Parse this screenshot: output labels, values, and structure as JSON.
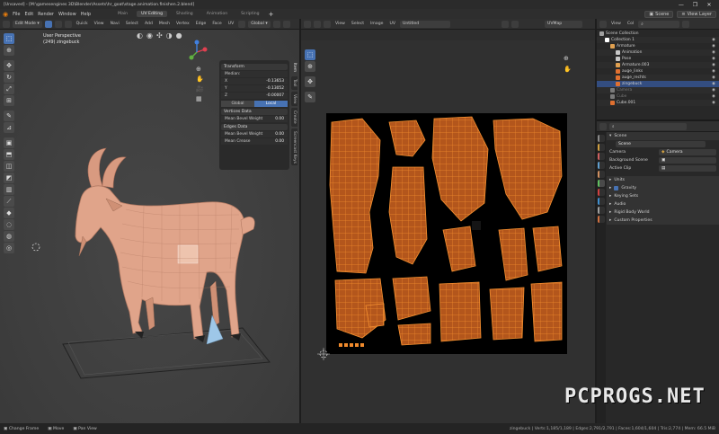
{
  "window": {
    "title": "[Unsaved] - [M:\\gamesengines 3D\\Blender\\Assets\\hr_goat\\stage.animation.finishen.2.blend]",
    "controls": [
      "—",
      "❐",
      "✕"
    ]
  },
  "menu": {
    "items": [
      "File",
      "Edit",
      "Render",
      "Window",
      "Help"
    ],
    "workspaces": [
      "Main",
      "UV Editing",
      "Shading",
      "Animation",
      "Scripting"
    ],
    "active_workspace": "UV Editing",
    "scene": "Scene",
    "view_layer": "View Layer"
  },
  "viewport3d": {
    "mode": "Edit Mode",
    "header_items": [
      "Quick",
      "View",
      "Navi",
      "Select",
      "Add",
      "Mesh",
      "Vertex",
      "Edge",
      "Face",
      "UV"
    ],
    "orientation": "Global",
    "view_name": "User Perspective",
    "object_name": "(249) zingebuck",
    "tools": [
      "select",
      "cursor",
      "move",
      "rotate",
      "scale",
      "transform",
      "annotate",
      "measure",
      "add-cube",
      "extrude",
      "inset",
      "bevel",
      "loop-cut",
      "knife",
      "poly-build",
      "spin",
      "smooth",
      "shrink",
      "shear",
      "rip"
    ],
    "side_tabs": [
      "Item",
      "Tool",
      "View",
      "Create",
      "Screencast Keys"
    ]
  },
  "transform_panel": {
    "title": "Transform",
    "median_label": "Median:",
    "x_label": "X",
    "x_value": "-0.13653",
    "y_label": "Y",
    "y_value": "-0.13052",
    "z_label": "Z",
    "z_value": "-0.00007",
    "global_label": "Global",
    "local_label": "Local",
    "vertices_section": "Vertices Data",
    "mean_bevel_vertex_label": "Mean Bevel Weight",
    "mean_bevel_vertex_value": "0.00",
    "edges_section": "Edges Data",
    "mean_bevel_edge_label": "Mean Bevel Weight",
    "mean_bevel_edge_value": "0.00",
    "mean_crease_label": "Mean Crease",
    "mean_crease_value": "0.00"
  },
  "uv_editor": {
    "header_items": [
      "View",
      "Select",
      "Image",
      "UV"
    ],
    "image_name": "Untitled",
    "uv_map": "UVMap"
  },
  "outliner": {
    "header_items": [
      "View",
      "Col"
    ],
    "rows": [
      {
        "label": "Scene Collection",
        "depth": 0,
        "color": "#a0a0a0",
        "selected": false,
        "dim": false
      },
      {
        "label": "Collection 1",
        "depth": 1,
        "color": "#ffffff",
        "selected": false,
        "dim": false
      },
      {
        "label": "Armature",
        "depth": 2,
        "color": "#e0a050",
        "selected": false,
        "dim": false
      },
      {
        "label": "Animation",
        "depth": 3,
        "color": "#c8c8c8",
        "selected": false,
        "dim": false
      },
      {
        "label": "Pose",
        "depth": 3,
        "color": "#c8c8c8",
        "selected": false,
        "dim": false
      },
      {
        "label": "Armature.003",
        "depth": 3,
        "color": "#e0a050",
        "selected": false,
        "dim": false
      },
      {
        "label": "auge_links",
        "depth": 3,
        "color": "#e07030",
        "selected": false,
        "dim": false
      },
      {
        "label": "auge_rechts",
        "depth": 3,
        "color": "#e07030",
        "selected": false,
        "dim": false
      },
      {
        "label": "zingebuck",
        "depth": 3,
        "color": "#e07030",
        "selected": true,
        "dim": false
      },
      {
        "label": "Camera",
        "depth": 2,
        "color": "#7a7a7a",
        "selected": false,
        "dim": true
      },
      {
        "label": "Cube",
        "depth": 2,
        "color": "#7a7a7a",
        "selected": false,
        "dim": true
      },
      {
        "label": "Cube.001",
        "depth": 2,
        "color": "#e07030",
        "selected": false,
        "dim": false
      }
    ]
  },
  "properties": {
    "scene_label": "Scene",
    "scene_field": "Scene",
    "camera_label": "Camera",
    "camera_value": "Camera",
    "background_label": "Background Scene",
    "active_clip_label": "Active Clip",
    "sections": [
      "Units",
      "Gravity",
      "Keying Sets",
      "Audio",
      "Rigid Body World",
      "Custom Properties"
    ],
    "tab_colors": [
      "#8a8a8a",
      "#d0a040",
      "#d06060",
      "#60a0d0",
      "#d09060",
      "#60c060",
      "#d04040",
      "#4090d0",
      "#a0a0a0",
      "#d07040"
    ]
  },
  "status": {
    "left": [
      "Change Frame",
      "Move",
      "Pan View"
    ],
    "stats": "zingebuck | Verts:1,185/1,189 | Edges:2,791/2,791 | Faces:1,604/1,604 | Tris:2,774 | Mem: 66.5 MiB"
  },
  "watermark": "PCPROGS.NET",
  "colors": {
    "accent": "#4772b3",
    "uv_orange": "#e07a20",
    "goat": "#e0a48a"
  }
}
